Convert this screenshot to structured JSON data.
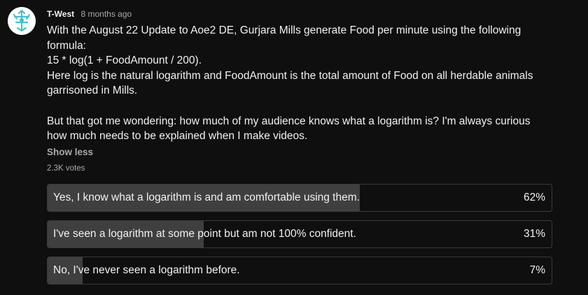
{
  "post": {
    "author": "T-West",
    "time": "8 months ago",
    "avatar_icon": "arrow-emblem-icon",
    "body": "With the August 22 Update to Aoe2 DE, Gurjara Mills generate Food per minute using the following formula:\n15 * log(1 + FoodAmount / 200).\nHere log is the natural logarithm and FoodAmount is the total amount of Food on all herdable animals garrisoned in Mills.\n\nBut that got me wondering: how much of my audience knows what a logarithm is? I'm always curious how much needs to be explained when I make videos.",
    "show_less": "Show less",
    "votes": "2.3K votes"
  },
  "poll": {
    "options": [
      {
        "label": "Yes, I know what a logarithm is and am comfortable using them.",
        "percent_text": "62%",
        "percent": 62
      },
      {
        "label": "I've seen a logarithm at some point but am not 100% confident.",
        "percent_text": "31%",
        "percent": 31
      },
      {
        "label": "No, I've never seen a logarithm before.",
        "percent_text": "7%",
        "percent": 7
      }
    ]
  },
  "colors": {
    "background": "#0f0f0f",
    "bar_fill": "#3f3f3f",
    "border": "#3a3a3a",
    "avatar_icon": "#3bbfcf"
  }
}
